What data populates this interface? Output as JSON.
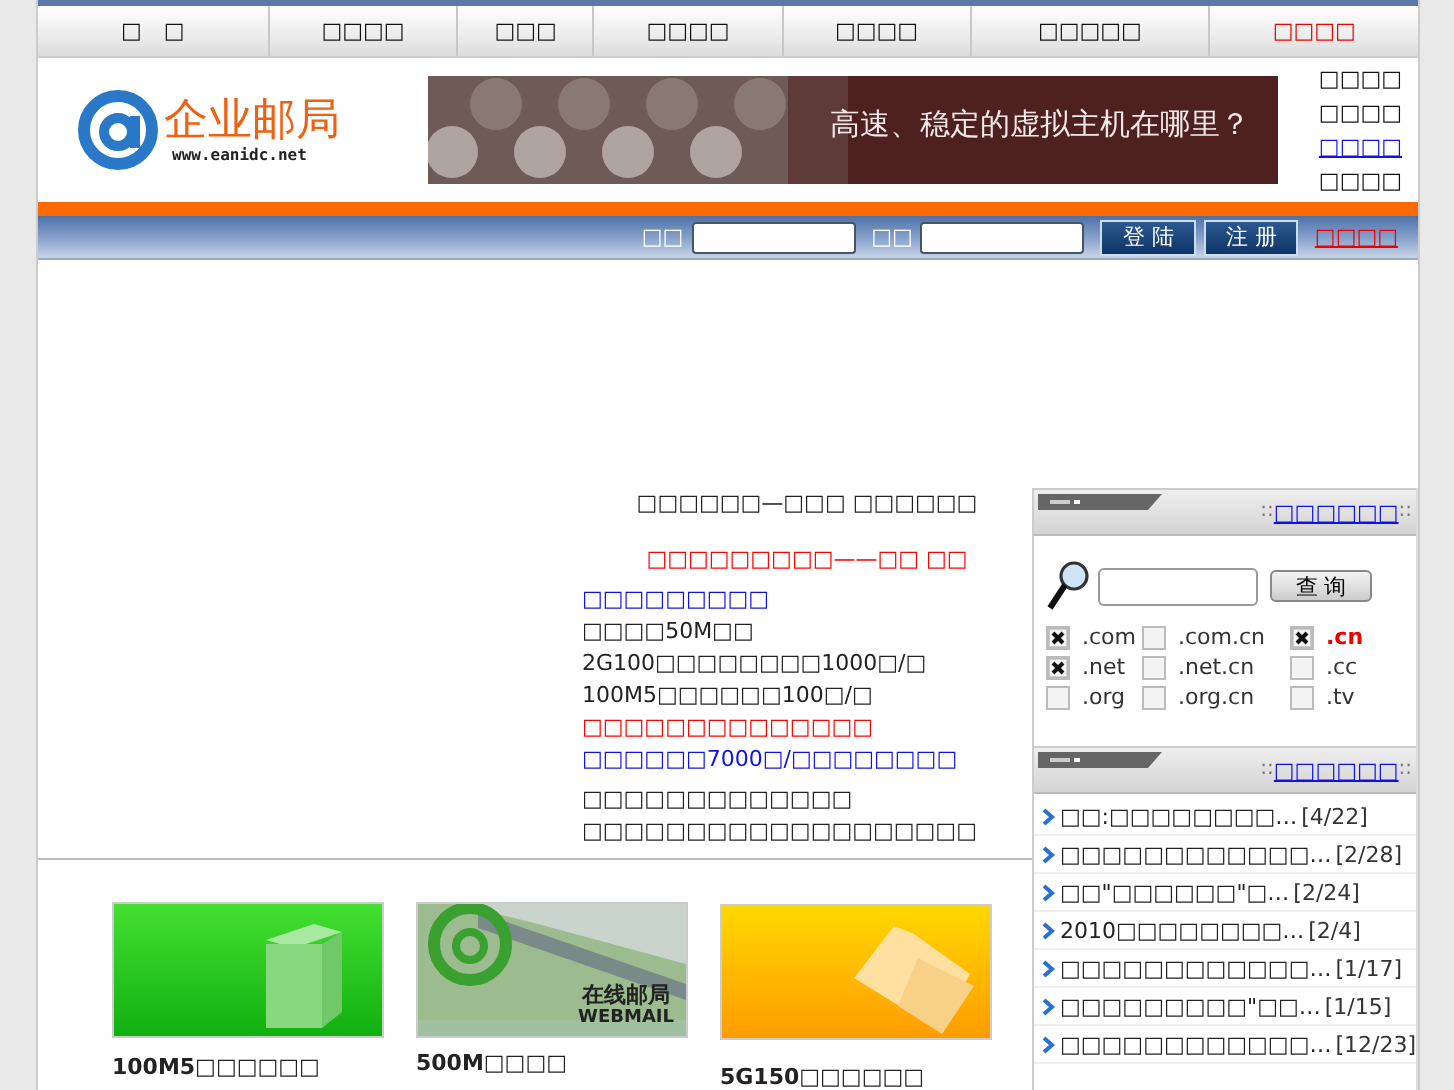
{
  "nav": [
    {
      "label": "□　□",
      "kind": "normal"
    },
    {
      "label": "□□□□",
      "kind": "normal"
    },
    {
      "label": "□□□",
      "kind": "normal"
    },
    {
      "label": "□□□□",
      "kind": "normal"
    },
    {
      "label": "□□□□",
      "kind": "normal"
    },
    {
      "label": "□□□□□",
      "kind": "normal"
    },
    {
      "label": "□□□□",
      "kind": "highlight"
    }
  ],
  "header": {
    "logo_title": "企业邮局",
    "logo_url": "www.eanidc.net",
    "banner_text": "高速、稳定的虚拟主机在哪里？",
    "links": [
      {
        "label": "□□□□",
        "selected": false
      },
      {
        "label": "□□□□",
        "selected": false
      },
      {
        "label": "□□□□",
        "selected": true
      },
      {
        "label": "□□□□",
        "selected": false
      }
    ]
  },
  "login": {
    "user_label": "□□",
    "password_label": "□□",
    "login_button": "登 陆",
    "register_button": "注 册",
    "forgot_link": "□□□□"
  },
  "promo": [
    {
      "text": "□□□□□□—□□□ □□□□□□",
      "kind": "heading"
    },
    {
      "text": "□□□□□□□□□——□□ □□",
      "kind": "notice"
    },
    {
      "text": "□□□□□□□□□",
      "kind": "link"
    },
    {
      "text": "□□□□50M□□",
      "kind": "text"
    },
    {
      "text": "2G100□□□□□□□□1000□/□",
      "kind": "text"
    },
    {
      "text": "100M5□□□□□□100□/□",
      "kind": "text"
    },
    {
      "text": "□□□□□□□□□□□□□□",
      "kind": "warning"
    },
    {
      "text": "□□□□□□7000□/□□□□□□□□",
      "kind": "link"
    },
    {
      "text": "□□□□□□□□□□□□□",
      "kind": "text"
    },
    {
      "text": "□□□□□□□□□□□□□□□□□□□",
      "kind": "text"
    }
  ],
  "domain_search": {
    "header_prefix": "::",
    "title": "□□□□□□",
    "header_suffix": "::",
    "button": "查 询",
    "domains": [
      {
        "label": ".com",
        "checked": true,
        "highlight": false
      },
      {
        "label": ".com.cn",
        "checked": false,
        "highlight": false
      },
      {
        "label": ".cn",
        "checked": true,
        "highlight": true
      },
      {
        "label": ".net",
        "checked": true,
        "highlight": false
      },
      {
        "label": ".net.cn",
        "checked": false,
        "highlight": false
      },
      {
        "label": ".cc",
        "checked": false,
        "highlight": false
      },
      {
        "label": ".org",
        "checked": false,
        "highlight": false
      },
      {
        "label": ".org.cn",
        "checked": false,
        "highlight": false
      },
      {
        "label": ".tv",
        "checked": false,
        "highlight": false
      }
    ]
  },
  "news": {
    "header_prefix": "::",
    "title": "□□□□□□",
    "header_suffix": "::",
    "items": [
      {
        "title": "□□:□□□□□□□□…",
        "date": "[4/22]"
      },
      {
        "title": "□□□□□□□□□□□□…",
        "date": "[2/28]"
      },
      {
        "title": "□□\"□□□□□□\"□…",
        "date": "[2/24]"
      },
      {
        "title": "2010□□□□□□□□…",
        "date": "[2/4]"
      },
      {
        "title": "□□□□□□□□□□□□…",
        "date": "[1/17]"
      },
      {
        "title": "□□□□□□□□□\"□□…",
        "date": "[1/15]"
      },
      {
        "title": "□□□□□□□□□□□□…",
        "date": "[12/23]"
      }
    ]
  },
  "products": [
    {
      "kind": "server",
      "caption": "100M5□□□□□□"
    },
    {
      "kind": "webmail",
      "caption": "500M□□□□",
      "image_title": "在线邮局",
      "image_subtitle": "WEBMAIL"
    },
    {
      "kind": "folder",
      "caption": "5G150□□□□□□"
    }
  ]
}
